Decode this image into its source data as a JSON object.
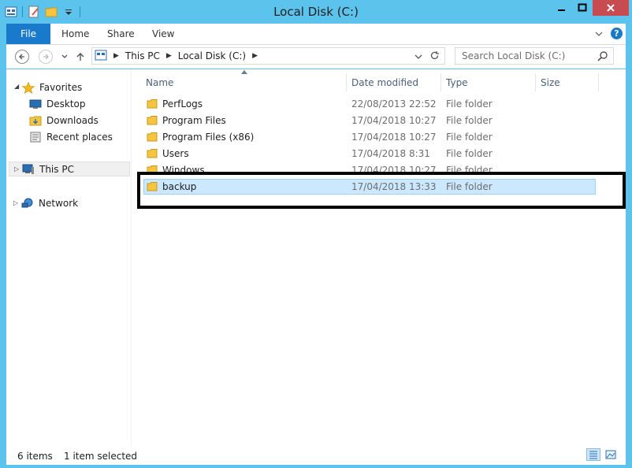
{
  "window": {
    "title": "Local Disk (C:)",
    "controls": {
      "minimize": "▬",
      "maximize": "□",
      "close": "✕"
    }
  },
  "ribbon": {
    "file_tab": "File",
    "tabs": [
      "Home",
      "Share",
      "View"
    ],
    "help": "?"
  },
  "address": {
    "crumbs": [
      "This PC",
      "Local Disk (C:)"
    ],
    "search_placeholder": "Search Local Disk (C:)"
  },
  "nav_pane": {
    "favorites": {
      "label": "Favorites",
      "items": [
        "Desktop",
        "Downloads",
        "Recent places"
      ]
    },
    "this_pc": "This PC",
    "network": "Network"
  },
  "columns": {
    "name": "Name",
    "date_modified": "Date modified",
    "type": "Type",
    "size": "Size"
  },
  "files": [
    {
      "name": "PerfLogs",
      "date": "22/08/2013 22:52",
      "type": "File folder"
    },
    {
      "name": "Program Files",
      "date": "17/04/2018 10:27",
      "type": "File folder"
    },
    {
      "name": "Program Files (x86)",
      "date": "17/04/2018 10:27",
      "type": "File folder"
    },
    {
      "name": "Users",
      "date": "17/04/2018 8:31",
      "type": "File folder"
    },
    {
      "name": "Windows",
      "date": "17/04/2018 10:27",
      "type": "File folder"
    },
    {
      "name": "backup",
      "date": "17/04/2018 13:33",
      "type": "File folder",
      "selected": true
    }
  ],
  "status": {
    "item_count": "6 items",
    "selection": "1 item selected"
  },
  "colors": {
    "frame": "#5bc3ec",
    "file_tab": "#1979ca",
    "selection": "#cce8ff",
    "close": "#c74b50"
  }
}
